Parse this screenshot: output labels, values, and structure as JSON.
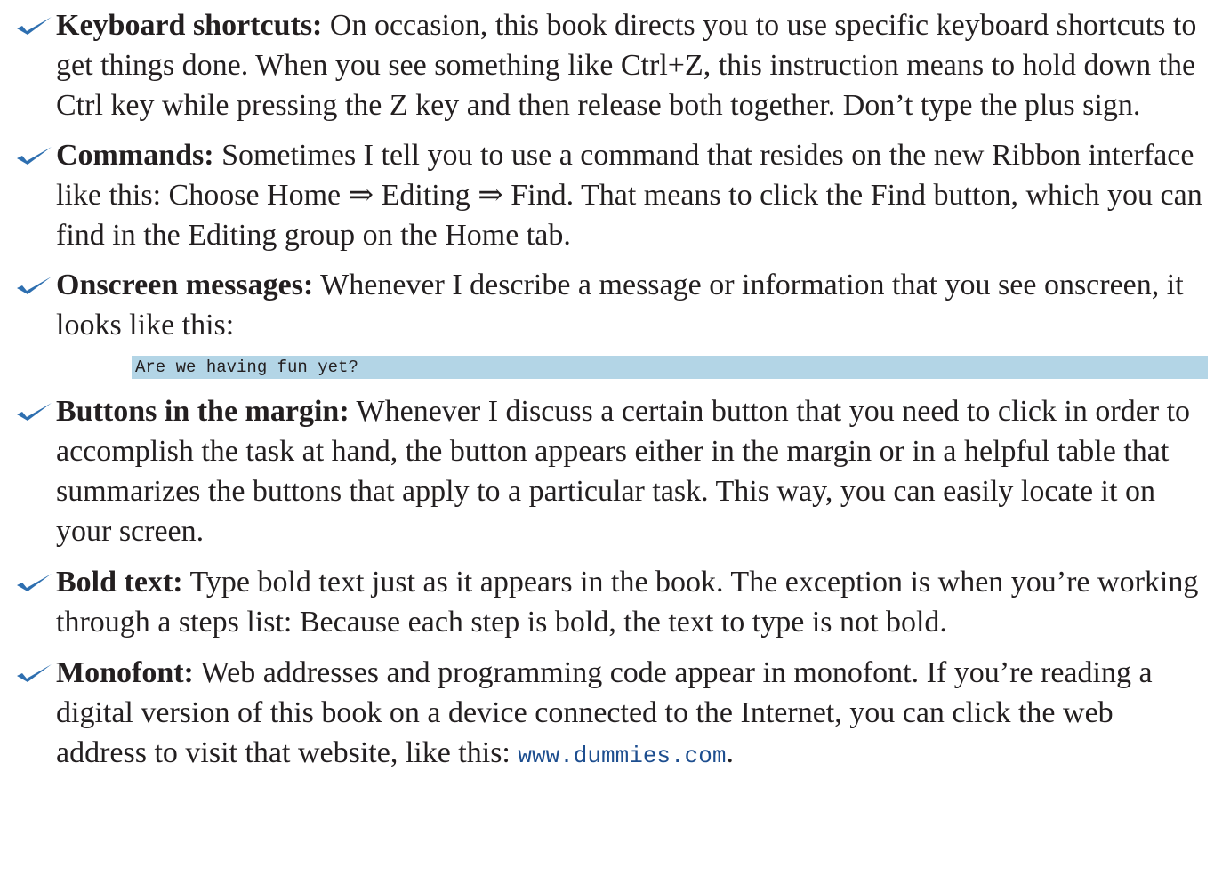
{
  "items": [
    {
      "term": "Keyboard shortcuts:",
      "text": "On occasion, this book directs you to use specific keyboard shortcuts to get things done. When you see something like Ctrl+Z, this instruction means to hold down the Ctrl key while pressing the Z key and then release both together. Don’t type the plus sign."
    },
    {
      "term": "Commands:",
      "text": "Sometimes I tell you to use a command that resides on the new Ribbon interface like this: Choose Home ⇒ Editing ⇒ Find. That means to click the Find button, which you can find in the Editing group on the Home tab."
    },
    {
      "term": "Onscreen messages:",
      "text": "Whenever I describe a message or information that you see onscreen, it looks like this:"
    },
    {
      "term": "Buttons in the margin:",
      "text": "Whenever I discuss a certain button that you need to click in order to accomplish the task at hand, the button appears either in the margin or in a helpful table that summarizes the buttons that apply to a particular task. This way, you can easily locate it on your screen."
    },
    {
      "term": "Bold text:",
      "text": "Type bold text just as it appears in the book. The exception is when you’re working through a steps list: Because each step is bold, the text to type is not bold."
    },
    {
      "term": "Monofont:",
      "text": "Web addresses and programming code appear in monofont. If you’re reading a digital version of this book on a device connected to the Internet, you can click the web address to visit that website, like this:",
      "link": "www.dummies.com",
      "after": "."
    }
  ],
  "code_sample": "Are we having fun yet?",
  "colors": {
    "check": "#2e6fb0",
    "code_bg": "#b3d5e6",
    "link": "#1d4e8f"
  },
  "icons": {
    "bullet": "checkmark-icon"
  }
}
